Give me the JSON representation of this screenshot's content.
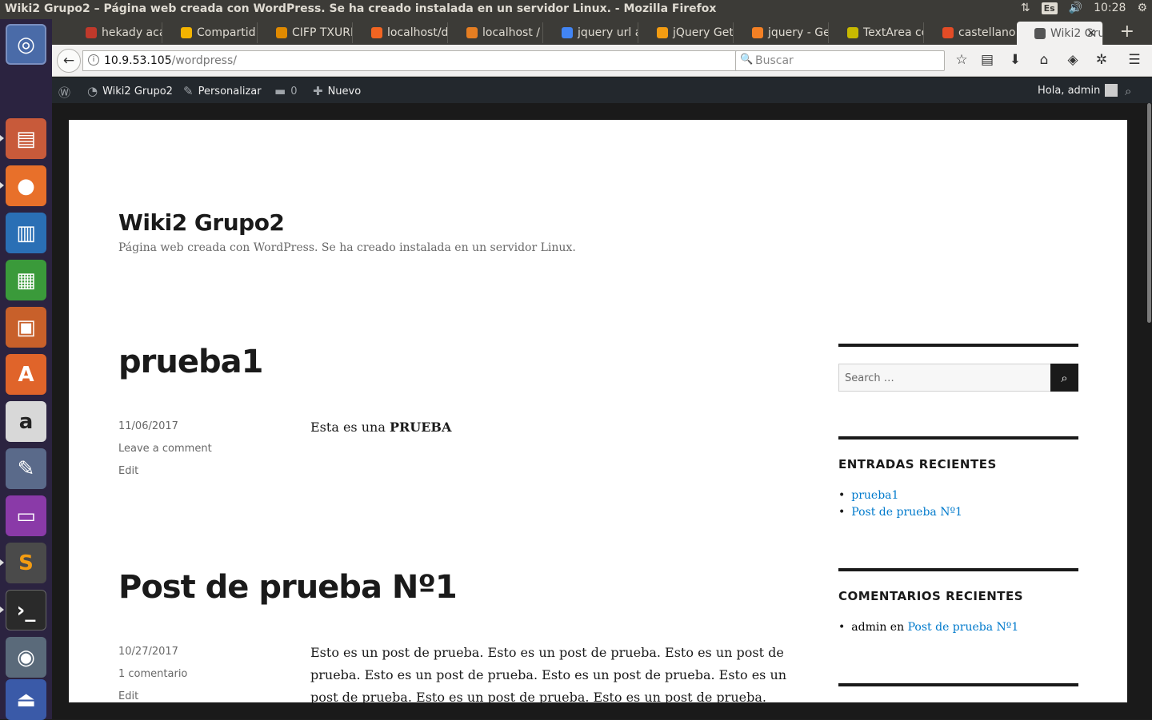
{
  "window": {
    "title": "Wiki2 Grupo2 – Página web creada con WordPress. Se ha creado instalada en un servidor Linux. - Mozilla Firefox",
    "keyboard": "Es",
    "clock": "10:28"
  },
  "tabs": [
    {
      "label": "hekady aca",
      "color": "#c0392b"
    },
    {
      "label": "Compartid",
      "color": "#f4b400"
    },
    {
      "label": "CIFP TXURD",
      "color": "#e08a00"
    },
    {
      "label": "localhost/d",
      "color": "#f26522"
    },
    {
      "label": "localhost /",
      "color": "#e67e22"
    },
    {
      "label": "jquery url a",
      "color": "#4285f4"
    },
    {
      "label": "jQuery Get",
      "color": "#f39c12"
    },
    {
      "label": "jquery - Get",
      "color": "#f48024"
    },
    {
      "label": "TextArea cc",
      "color": "#c8b900"
    },
    {
      "label": "castellano",
      "color": "#e34c26"
    },
    {
      "label": "Wiki2 Gru",
      "color": "#555555"
    }
  ],
  "navbar": {
    "url_host": "10.9.53.105",
    "url_path": "/wordpress/",
    "search_placeholder": "Buscar"
  },
  "adminbar": {
    "site": "Wiki2 Grupo2",
    "customize": "Personalizar",
    "comments_count": "0",
    "new": "Nuevo",
    "greeting": "Hola, admin"
  },
  "site": {
    "title": "Wiki2 Grupo2",
    "description": "Página web creada con WordPress. Se ha creado instalada en un servidor Linux."
  },
  "posts": [
    {
      "title": "prueba1",
      "date": "11/06/2017",
      "comments": "Leave a comment",
      "edit": "Edit",
      "body_prefix": "Esta es una ",
      "body_bold": "PRUEBA"
    },
    {
      "title": "Post de prueba Nº1",
      "date": "10/27/2017",
      "comments": "1 comentario",
      "edit": "Edit",
      "body": "Esto es un post de prueba. Esto es un post de prueba. Esto es un post de prueba. Esto es un post de prueba. Esto es un post de prueba. Esto es un post de prueba. Esto es un post de prueba. Esto es un post de prueba. Esto"
    }
  ],
  "sidebar": {
    "search_placeholder": "Search …",
    "recent_posts_title": "ENTRADAS RECIENTES",
    "recent_posts": [
      "prueba1",
      "Post de prueba Nº1"
    ],
    "recent_comments_title": "COMENTARIOS RECIENTES",
    "recent_comment_author": "admin",
    "recent_comment_on": "en",
    "recent_comment_post": "Post de prueba Nº1"
  }
}
